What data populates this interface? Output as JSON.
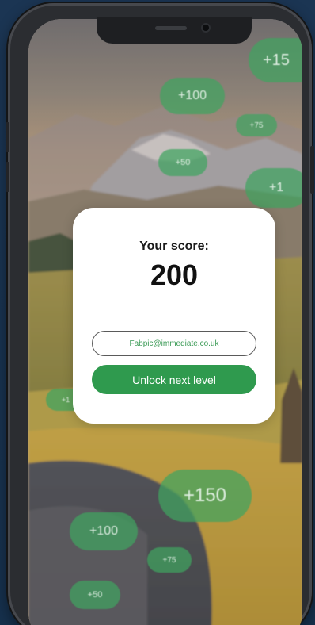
{
  "dialog": {
    "score_label": "Your score:",
    "score_value": "200",
    "email_value": "Fabpic@immediate.co.uk",
    "unlock_label": "Unlock next level"
  },
  "floating_points": [
    {
      "id": "a",
      "label": "+15"
    },
    {
      "id": "b",
      "label": "+100"
    },
    {
      "id": "c",
      "label": "+75"
    },
    {
      "id": "d",
      "label": "+50"
    },
    {
      "id": "e",
      "label": "+1"
    },
    {
      "id": "f",
      "label": "+1"
    },
    {
      "id": "g",
      "label": "+150"
    },
    {
      "id": "h",
      "label": "+100"
    },
    {
      "id": "i",
      "label": "+75"
    },
    {
      "id": "j",
      "label": "+50"
    }
  ],
  "colors": {
    "accent_green": "#2f9a4e",
    "bubble_green": "#40a460",
    "card_bg": "#ffffff",
    "backdrop": "#1c3350"
  }
}
